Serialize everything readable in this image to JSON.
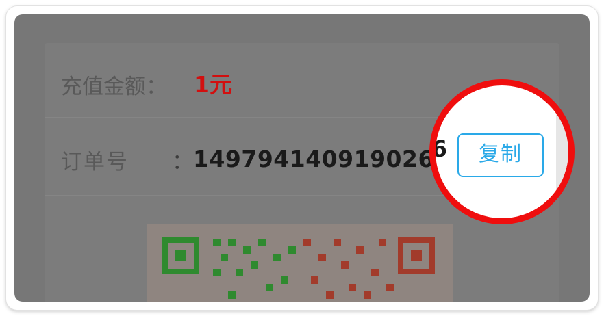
{
  "recharge": {
    "amount_label": "充值金额：",
    "amount_value": "1元"
  },
  "order": {
    "label": "订单号",
    "colon": "：",
    "number": "149794140919026",
    "copy_label": "复制"
  },
  "colors": {
    "amount": "#d20f0f",
    "copy_button": "#2aa9e8",
    "highlight_ring": "#ef0e0e",
    "qr_green": "#2f8a2f",
    "qr_red": "#a23b2b"
  },
  "icons": {
    "qr": "qr-code-icon"
  }
}
